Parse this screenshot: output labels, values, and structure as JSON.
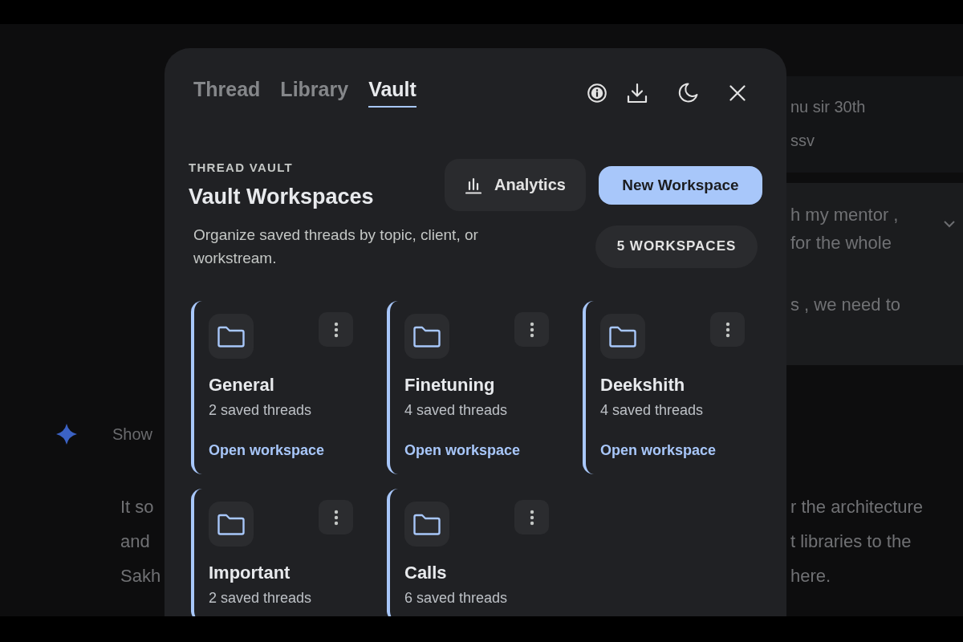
{
  "background": {
    "message_cards": [
      {
        "kind": "plain",
        "paragraphs": [
          [
            "nu sir 30th",
            "ssv"
          ]
        ]
      },
      {
        "kind": "collapsible",
        "paragraphs": [
          [
            "h my mentor ,",
            "for the whole"
          ],
          [
            "s , we need to"
          ]
        ]
      }
    ],
    "response": {
      "heading": "Show",
      "lines_left": [
        "It so",
        "and",
        "Sakh"
      ],
      "lines_right": [
        "r the architecture",
        "t libraries to the",
        "here."
      ]
    }
  },
  "panel": {
    "tabs": [
      {
        "label": "Thread",
        "selected": false
      },
      {
        "label": "Library",
        "selected": false
      },
      {
        "label": "Vault",
        "selected": true
      }
    ],
    "eyebrow": "THREAD VAULT",
    "title": "Vault Workspaces",
    "description": "Organize saved threads by topic, client, or workstream.",
    "analytics_button": "Analytics",
    "new_workspace_button": "New Workspace",
    "count_badge": "5 WORKSPACES",
    "workspaces": [
      {
        "name": "General",
        "count": "2 saved threads",
        "link": "Open workspace"
      },
      {
        "name": "Finetuning",
        "count": "4 saved threads",
        "link": "Open workspace"
      },
      {
        "name": "Deekshith",
        "count": "4 saved threads",
        "link": "Open workspace"
      },
      {
        "name": "Important",
        "count": "2 saved threads"
      },
      {
        "name": "Calls",
        "count": "6 saved threads"
      }
    ]
  }
}
